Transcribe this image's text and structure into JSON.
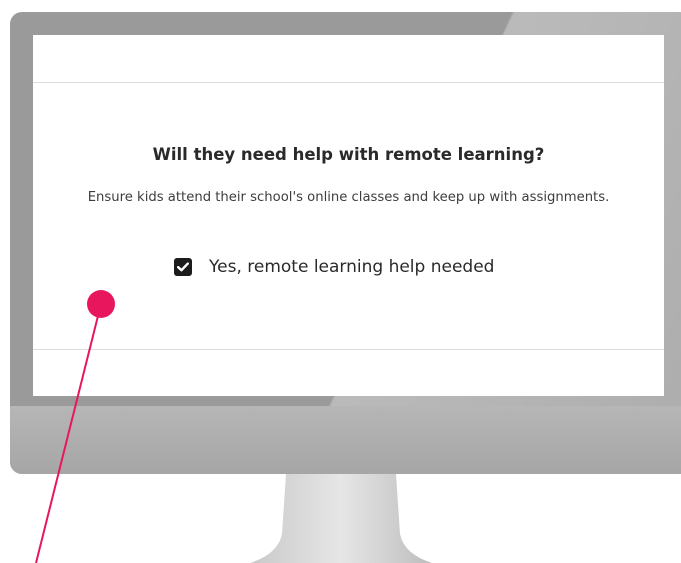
{
  "question": {
    "title": "Will they need help with remote learning?",
    "description": "Ensure kids attend their school's online classes and keep up with assignments."
  },
  "remote_learning_option": {
    "label": "Yes, remote learning help needed",
    "checked": true
  },
  "annotation": {
    "marker_color": "#e8175d"
  },
  "icons": {
    "checkbox": "check-icon"
  }
}
